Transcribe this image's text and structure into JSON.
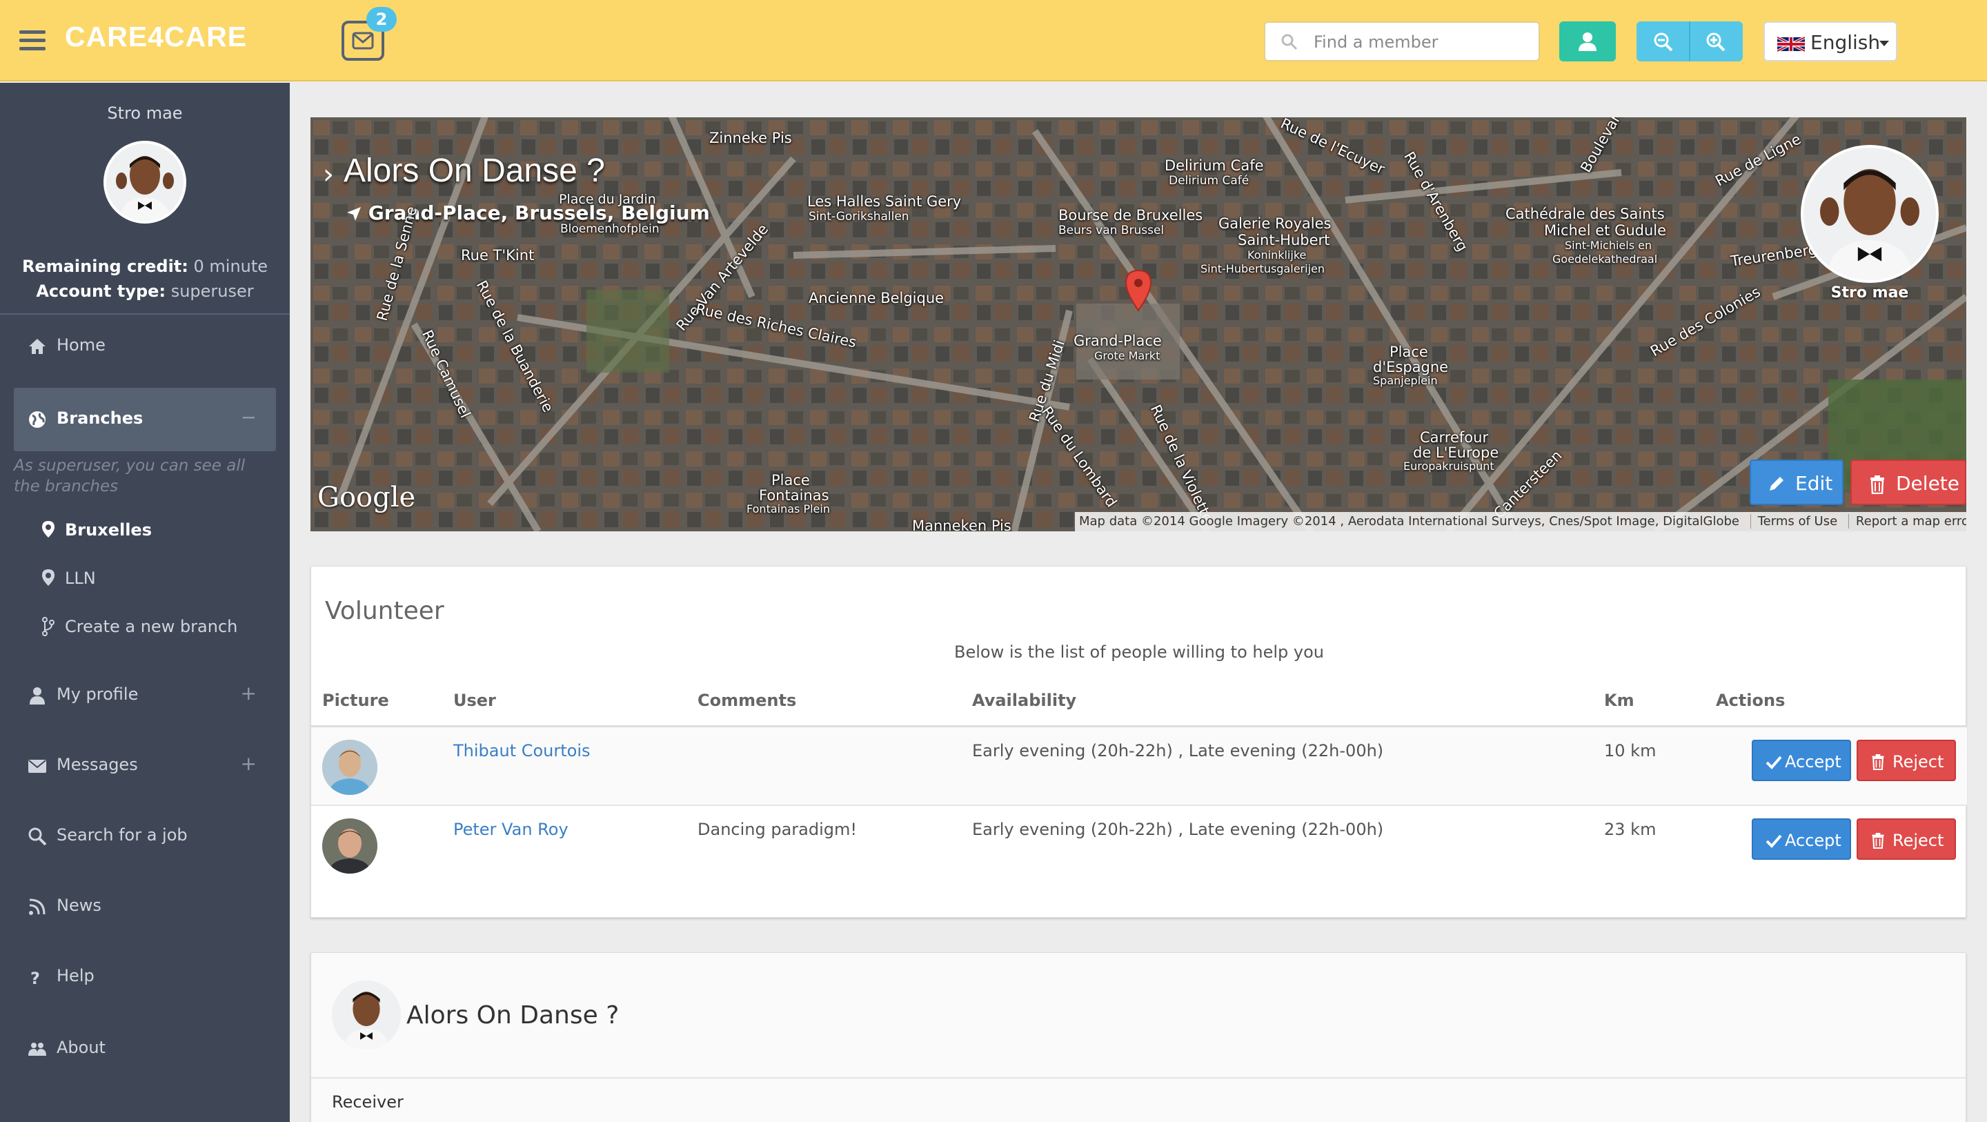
{
  "topbar": {
    "brand": "CARE4CARE",
    "mail_count": "2",
    "search_placeholder": "Find a member",
    "language": "English"
  },
  "sidebar": {
    "username": "Stro mae",
    "remaining_credit_label": "Remaining credit:",
    "remaining_credit_value": "0 minute",
    "account_type_label": "Account type:",
    "account_type_value": "superuser",
    "nav": {
      "home": "Home",
      "branches": "Branches",
      "branches_toggle": "−",
      "branches_note": "As superuser, you can see all the branches",
      "branch_items": [
        "Bruxelles",
        "LLN",
        "Create a new branch"
      ],
      "my_profile": "My profile",
      "messages": "Messages",
      "expand": "+",
      "search_job": "Search for a job",
      "news": "News",
      "help": "Help",
      "about": "About"
    }
  },
  "map": {
    "title": "Alors On Danse ?",
    "location": "Grand-Place, Brussels, Belgium",
    "chevron": "›",
    "labels": [
      "Zinneke Pis",
      "Place du Jardin",
      "Bloemenhofplein",
      "Les Halles Saint Gery",
      "Sint-Gorikshallen",
      "Bourse de Bruxelles",
      "Beurs van Brussel",
      "Delirium Cafe",
      "Delirium Café",
      "Galerie Royales",
      "Saint-Hubert",
      "Koninklijke",
      "Sint-Hubertusgalerijen",
      "Cathédrale des Saints",
      "Michel et Gudule",
      "Sint-Michiels en",
      "Goedelekathedraal",
      "Rue T'Kint",
      "Rue Van Artevelde",
      "Ancienne Belgique",
      "Rue des Riches Claires",
      "Grand-Place",
      "Grote Markt",
      "Rue du Midi",
      "Rue du Lombard",
      "Rue de la Violette",
      "Place",
      "d'Espagne",
      "Spanjeplein",
      "Carrefour",
      "de L'Europe",
      "Europakruispunt",
      "Place",
      "Fontainas",
      "Fontainas Plein",
      "Manneken Pis",
      "Rue de la Senne",
      "Rue Camusel",
      "Rue de la Buanderie",
      "Rue d'Arenberg",
      "Rue de Ligne",
      "Treurenberg",
      "Rue des Colonies",
      "Rue de l'Ecuyer",
      "Cantersteen",
      "Boulevard"
    ],
    "avatar_name": "Stro mae",
    "edit_label": "Edit",
    "delete_label": "Delete",
    "google": "Google",
    "attribution": "Map data ©2014 Google Imagery ©2014 , Aerodata International Surveys, Cnes/Spot Image, DigitalGlobe",
    "terms": "Terms of Use",
    "report": "Report a map error"
  },
  "volunteer": {
    "title": "Volunteer",
    "subtitle": "Below is the list of people willing to help you",
    "columns": [
      "Picture",
      "User",
      "Comments",
      "Availability",
      "Km",
      "Actions"
    ],
    "rows": [
      {
        "user": "Thibaut Courtois",
        "comment": "",
        "availability": "Early evening (20h-22h) , Late evening (22h-00h)",
        "km": "10 km"
      },
      {
        "user": "Peter Van Roy",
        "comment": "Dancing paradigm!",
        "availability": "Early evening (20h-22h) , Late evening (22h-00h)",
        "km": "23 km"
      }
    ],
    "accept_label": "Accept",
    "reject_label": "Reject"
  },
  "job": {
    "title": "Alors On Danse ?",
    "receiver_label": "Receiver"
  },
  "colors": {
    "topbar": "#fcd86a",
    "sidebar": "#3f4756",
    "accent_teal": "#2ec4a6",
    "accent_blue": "#3a8ad8",
    "danger": "#e04b4b",
    "link": "#3a7fc4"
  },
  "icons": [
    "menu-icon",
    "envelope-icon",
    "search-icon",
    "user-icon",
    "zoom-out-icon",
    "zoom-in-icon",
    "uk-flag-icon",
    "home-icon",
    "globe-icon",
    "map-marker-icon",
    "branch-icon",
    "user-icon",
    "envelope-icon",
    "search-icon",
    "rss-icon",
    "question-icon",
    "users-icon",
    "location-arrow-icon",
    "pencil-icon",
    "trash-icon",
    "check-icon"
  ]
}
